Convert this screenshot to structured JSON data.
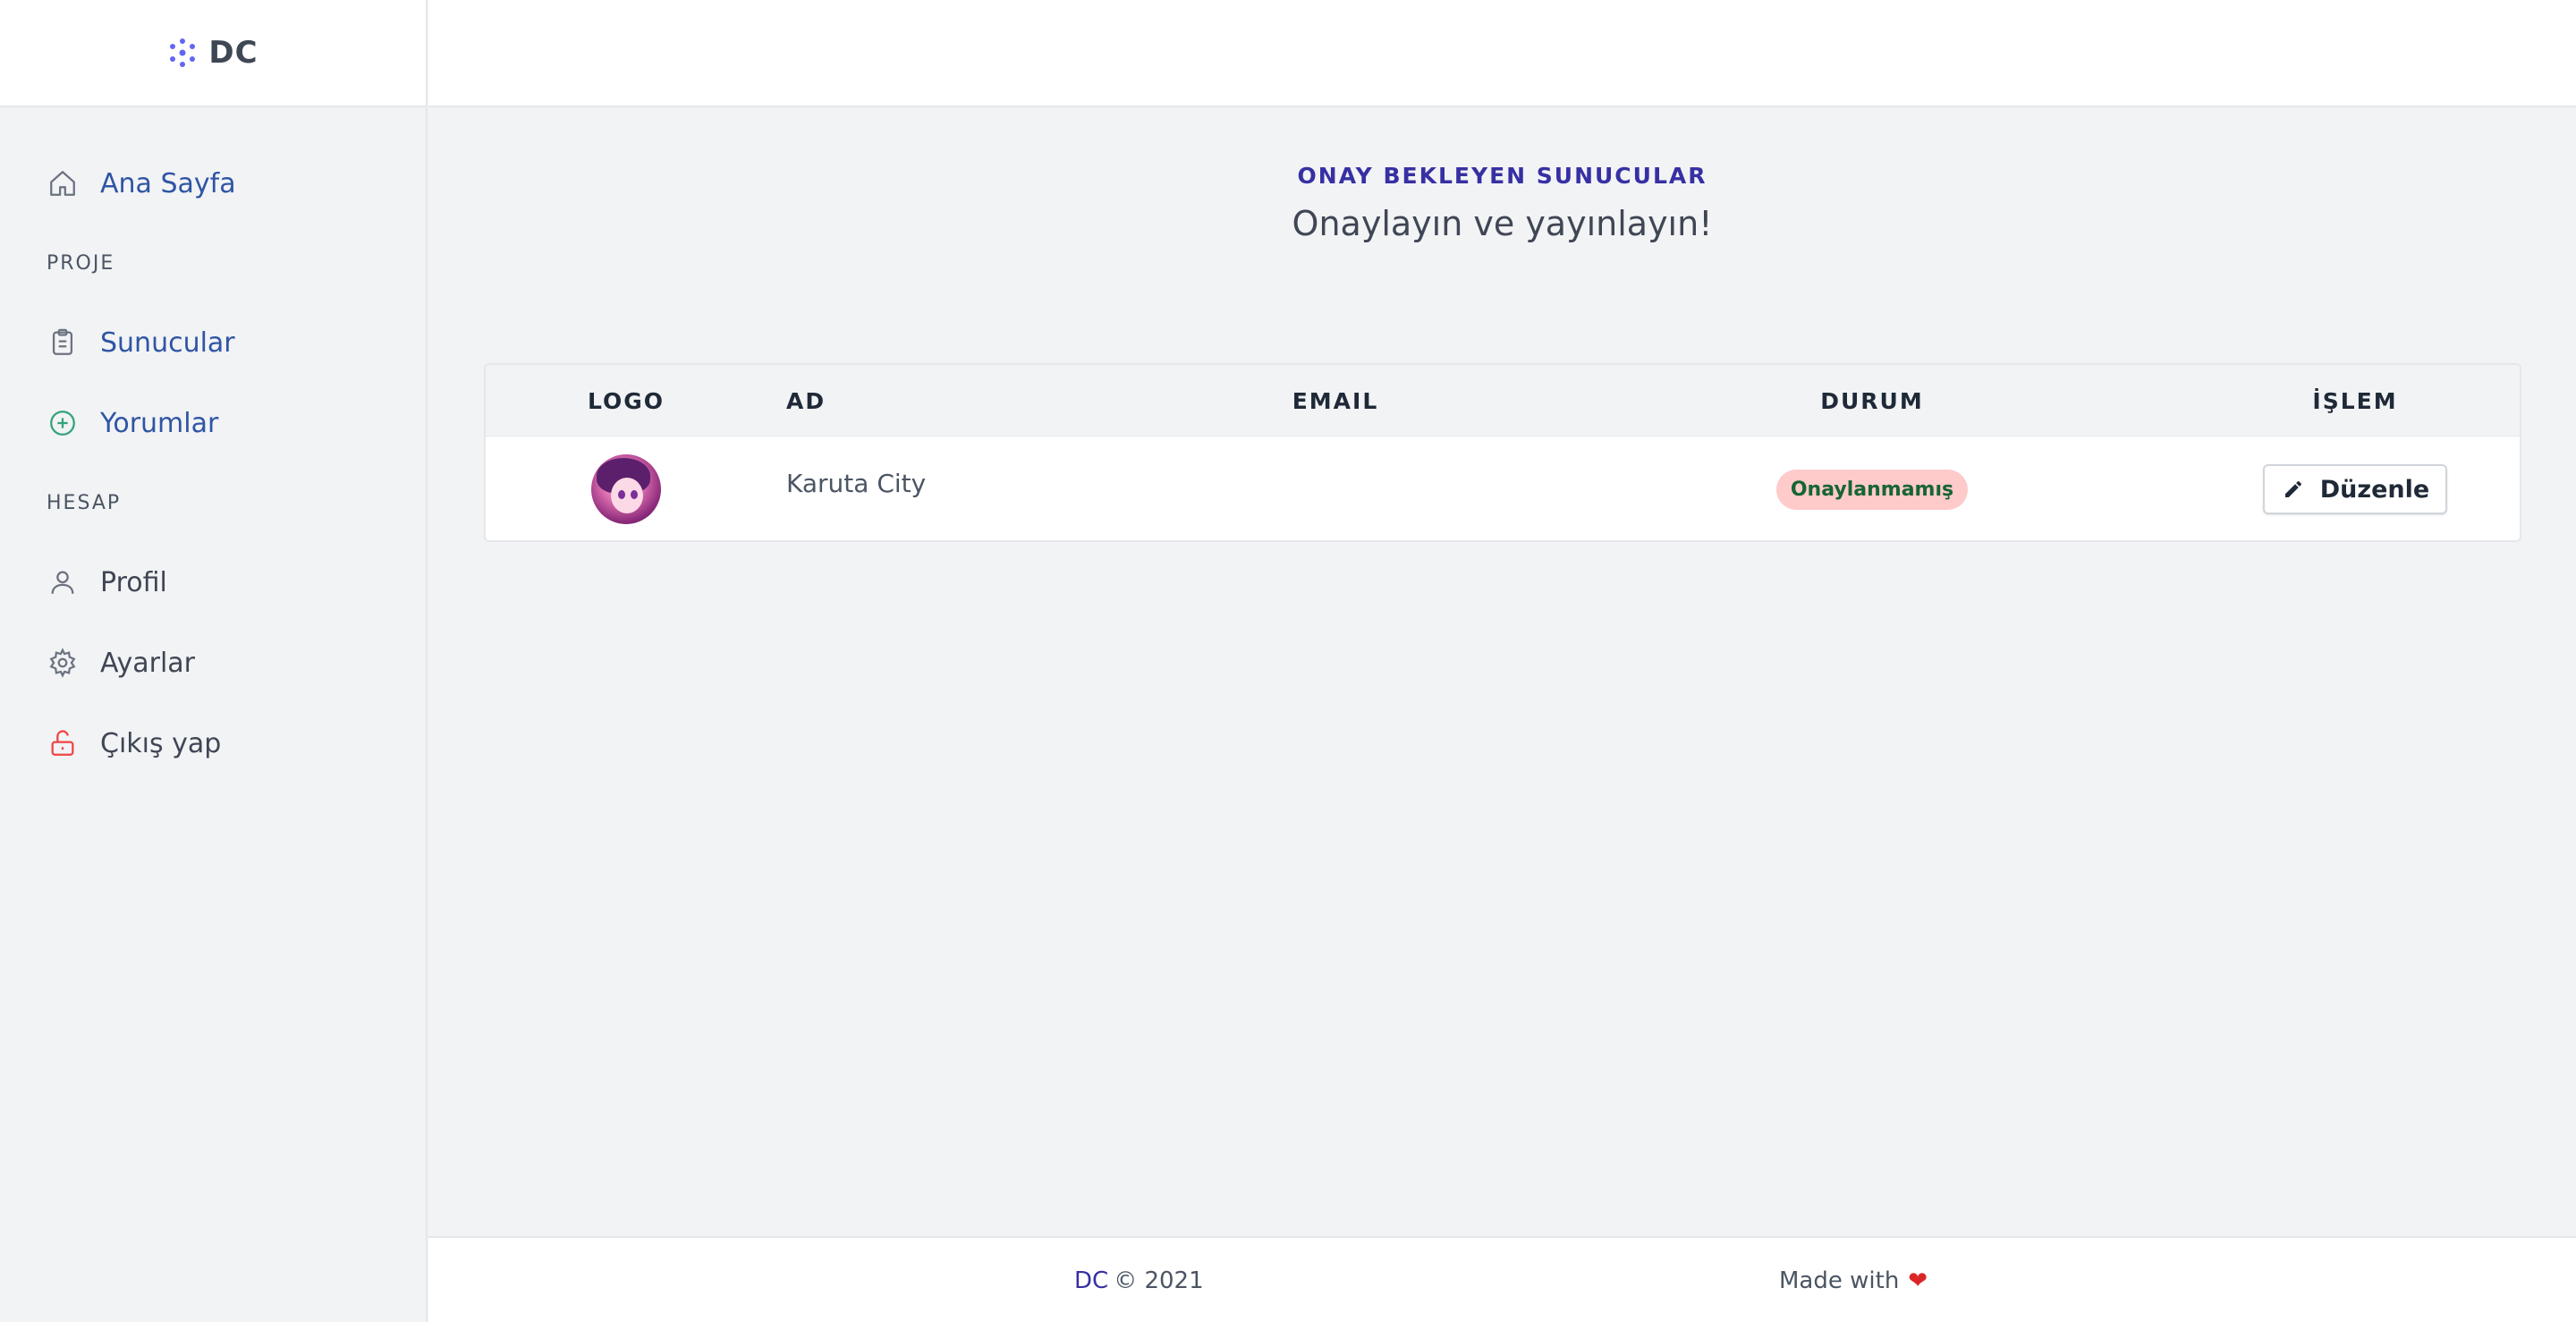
{
  "brand": {
    "name": "DC",
    "icon": "hexagon-dots-icon",
    "color": "#6366f1"
  },
  "sidebar": {
    "home": {
      "label": "Ana Sayfa",
      "icon": "home-icon"
    },
    "sections": [
      {
        "title": "PROJE",
        "items": [
          {
            "label": "Sunucular",
            "icon": "clipboard-icon"
          },
          {
            "label": "Yorumlar",
            "icon": "plus-circle-icon"
          }
        ]
      },
      {
        "title": "HESAP",
        "items": [
          {
            "label": "Profil",
            "icon": "user-icon"
          },
          {
            "label": "Ayarlar",
            "icon": "gear-icon"
          },
          {
            "label": "Çıkış yap",
            "icon": "unlock-icon"
          }
        ]
      }
    ]
  },
  "main": {
    "eyebrow": "ONAY BEKLEYEN SUNUCULAR",
    "headline": "Onaylayın ve yayınlayın!",
    "table": {
      "columns": [
        "LOGO",
        "AD",
        "EMAIL",
        "DURUM",
        "İŞLEM"
      ],
      "rows": [
        {
          "logo": "anime-avatar",
          "name": "Karuta City",
          "email": "",
          "status": "Onaylanmamış",
          "action": "Düzenle"
        }
      ]
    }
  },
  "footer": {
    "brand": "DC",
    "copyright": "© 2021",
    "made_with": "Made with",
    "heart": "❤"
  },
  "colors": {
    "accent": "#3730a3",
    "link": "#2f55a4",
    "status_bg": "#fecaca",
    "status_text": "#166534",
    "heart": "#dc2626"
  }
}
